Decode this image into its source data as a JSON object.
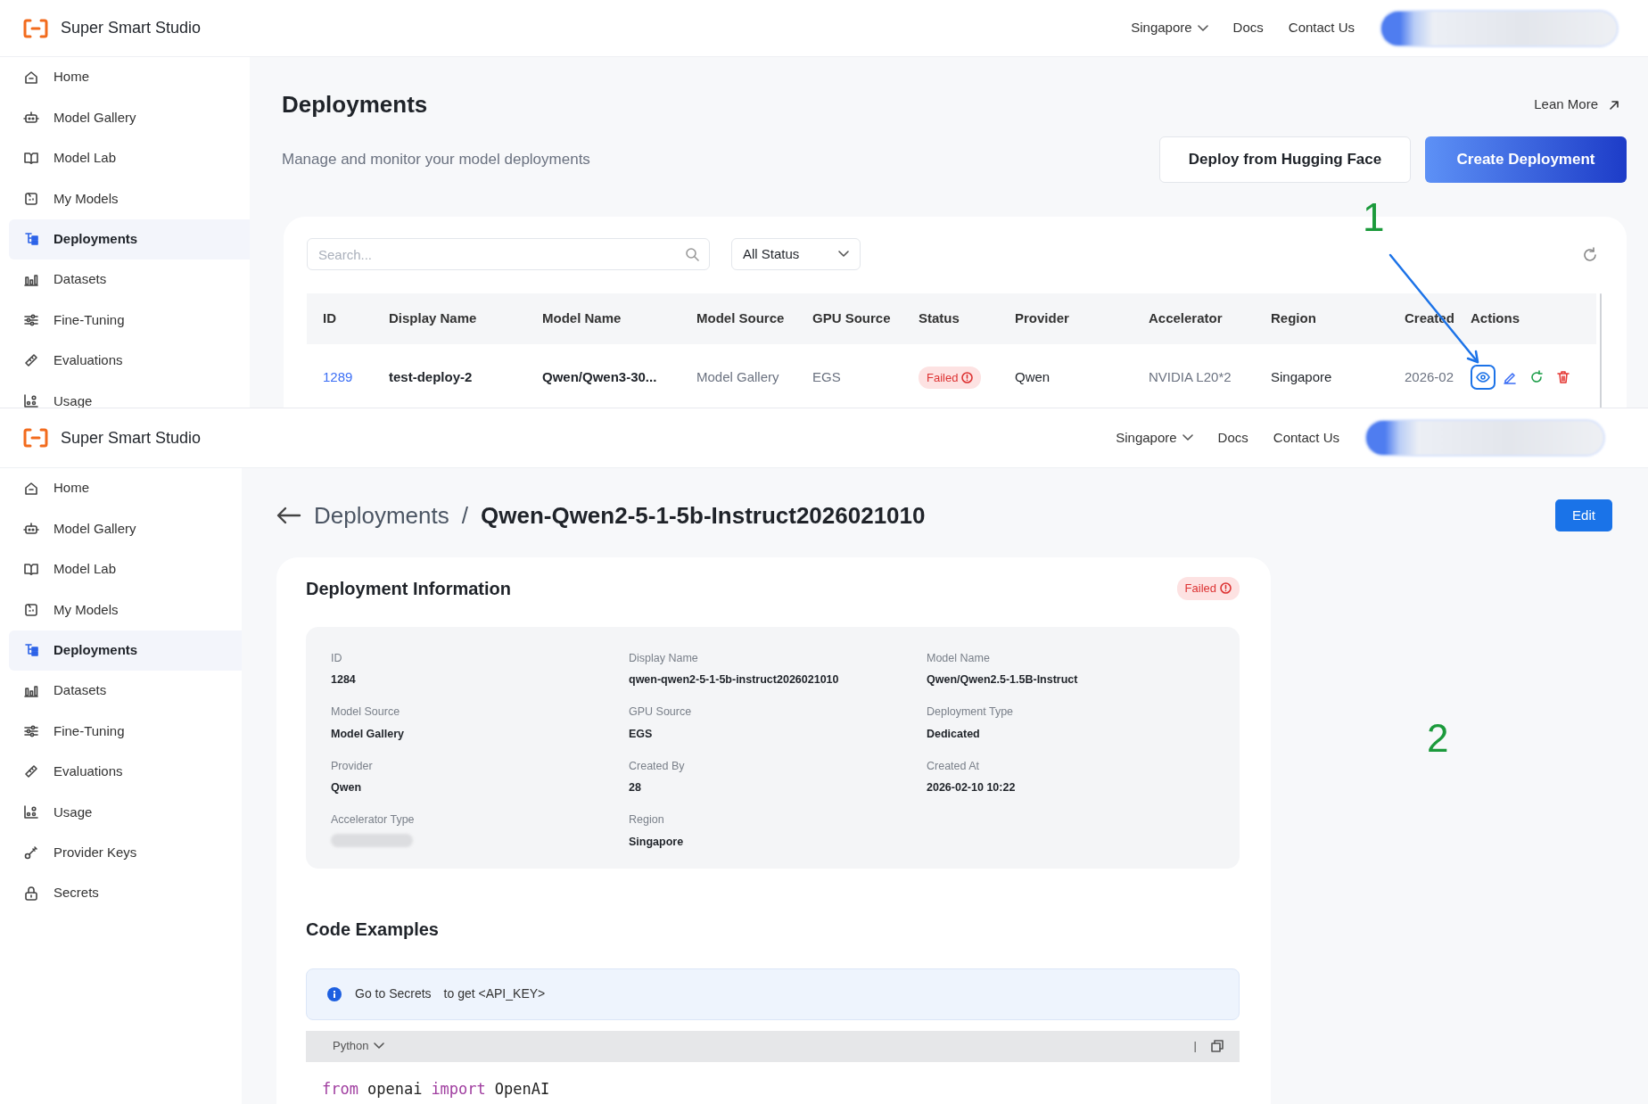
{
  "screens": [
    {
      "kind": "list",
      "brand": "Super Smart Studio",
      "header": {
        "region": "Singapore",
        "links": [
          "Docs",
          "Contact Us"
        ]
      },
      "sidebar": {
        "items": [
          {
            "label": "Home",
            "selected": false
          },
          {
            "label": "Model Gallery",
            "selected": false
          },
          {
            "label": "Model Lab",
            "selected": false
          },
          {
            "label": "My Models",
            "selected": false
          },
          {
            "label": "Deployments",
            "selected": true
          },
          {
            "label": "Datasets",
            "selected": false
          },
          {
            "label": "Fine-Tuning",
            "selected": false
          },
          {
            "label": "Evaluations",
            "selected": false
          },
          {
            "label": "Usage",
            "selected": false
          }
        ]
      },
      "page": {
        "title": "Deployments",
        "subtitle": "Manage and monitor your model deployments",
        "learn_more": "Lean More",
        "buttons": [
          {
            "label": "Deploy from Hugging Face",
            "kind": "outline"
          },
          {
            "label": "Create Deployment",
            "kind": "primary"
          }
        ]
      },
      "search": {
        "placeholder": "Search..."
      },
      "status_filter": "All Status",
      "table": {
        "columns": [
          "ID",
          "Display Name",
          "Model Name",
          "Model Source",
          "GPU Source",
          "Status",
          "Provider",
          "Accelerator",
          "Region",
          "Created",
          "Actions"
        ],
        "rows": [
          {
            "cells": [
              {
                "text": "1289",
                "kind": "link"
              },
              {
                "text": "test-deploy-2",
                "kind": "strong"
              },
              {
                "text": "Qwen/Qwen3-30...",
                "kind": "strong"
              },
              {
                "text": "Model Gallery",
                "kind": "muted"
              },
              {
                "text": "EGS",
                "kind": "muted"
              },
              {
                "text": "Failed",
                "kind": "status"
              },
              {
                "text": "Qwen",
                "kind": "plain"
              },
              {
                "text": "NVIDIA L20*2",
                "kind": "muted"
              },
              {
                "text": "Singapore",
                "kind": "plain"
              },
              {
                "text": "2026-02",
                "kind": "muted"
              }
            ],
            "actions": [
              {
                "kind": "view",
                "highlighted": true
              },
              {
                "kind": "edit",
                "highlighted": false
              },
              {
                "kind": "restart",
                "highlighted": false
              },
              {
                "kind": "delete",
                "highlighted": false
              }
            ]
          }
        ]
      }
    },
    {
      "kind": "detail",
      "brand": "Super Smart Studio",
      "header": {
        "region": "Singapore",
        "links": [
          "Docs",
          "Contact Us"
        ]
      },
      "sidebar": {
        "items": [
          {
            "label": "Home",
            "selected": false
          },
          {
            "label": "Model Gallery",
            "selected": false
          },
          {
            "label": "Model Lab",
            "selected": false
          },
          {
            "label": "My Models",
            "selected": false
          },
          {
            "label": "Deployments",
            "selected": true
          },
          {
            "label": "Datasets",
            "selected": false
          },
          {
            "label": "Fine-Tuning",
            "selected": false
          },
          {
            "label": "Evaluations",
            "selected": false
          },
          {
            "label": "Usage",
            "selected": false
          },
          {
            "label": "Provider Keys",
            "selected": false
          },
          {
            "label": "Secrets",
            "selected": false
          }
        ]
      },
      "breadcrumb": {
        "items": [
          "Deployments",
          "Qwen-Qwen2-5-1-5b-Instruct2026021010"
        ],
        "separator": "/"
      },
      "edit_button": "Edit",
      "info": {
        "title": "Deployment Information",
        "status": "Failed",
        "fields": [
          {
            "label": "ID",
            "value": "1284"
          },
          {
            "label": "Display Name",
            "value": "qwen-qwen2-5-1-5b-instruct2026021010"
          },
          {
            "label": "Model Name",
            "value": "Qwen/Qwen2.5-1.5B-Instruct"
          },
          {
            "label": "Model Source",
            "value": "Model Gallery"
          },
          {
            "label": "GPU Source",
            "value": "EGS"
          },
          {
            "label": "Deployment Type",
            "value": "Dedicated"
          },
          {
            "label": "Provider",
            "value": "Qwen"
          },
          {
            "label": "Created By",
            "value": "28"
          },
          {
            "label": "Created At",
            "value": "2026-02-10 10:22"
          },
          {
            "label": "Accelerator Type",
            "redacted": true
          },
          {
            "label": "Region",
            "value": "Singapore"
          }
        ]
      },
      "code": {
        "title": "Code Examples",
        "alert_link": "Go to Secrets",
        "alert_text": "to get <API_KEY>",
        "language": "Python",
        "separator": "|",
        "tokens": [
          {
            "text": "from",
            "kind": "keyword"
          },
          {
            "text": "openai",
            "kind": "name"
          },
          {
            "text": "import",
            "kind": "keyword"
          },
          {
            "text": "OpenAI",
            "kind": "name"
          }
        ]
      }
    }
  ],
  "annotations": [
    "1",
    "2"
  ]
}
